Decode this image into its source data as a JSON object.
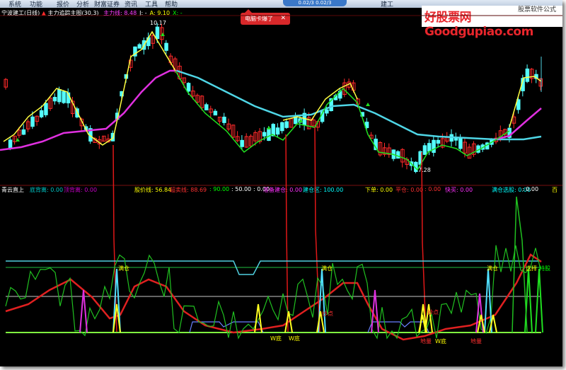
{
  "menu": {
    "items": [
      "系统",
      "功能",
      "报价",
      "分析",
      "财富证券",
      "资讯",
      "工具",
      "帮助"
    ],
    "top_pill": "0.02/3   0.02/3",
    "right_item": "建工"
  },
  "logo": {
    "text": "好股票网Goodgupiao.com",
    "sub": "股票软件公式"
  },
  "popup": {
    "text": "电脑卡爆了",
    "close": "✕"
  },
  "main_legend": {
    "stock": "宁波建工(日线)",
    "indicator": "主力追踪主图(30,3)",
    "fields": [
      {
        "label": "主力线:",
        "value": "8.48",
        "color": "#ff3bff"
      },
      {
        "label": "J:",
        "value": "-",
        "color": "#ffffff"
      },
      {
        "label": "A:",
        "value": "9.10",
        "color": "#ffff00"
      },
      {
        "label": "X:",
        "value": "-",
        "color": "#00ff00"
      }
    ],
    "icon_color": "#ff2a2a"
  },
  "main_annotations": {
    "high": "10.17",
    "low": "7.28"
  },
  "sub_legend": {
    "items": [
      {
        "text": "青云直上",
        "color": "#ffffff"
      },
      {
        "text": "底背离: 0.00",
        "color": "#00c8c8"
      },
      {
        "text": "顶背离: 0.00",
        "color": "#c800c8"
      },
      {
        "text": "股价线: 56.84",
        "color": "#ffff00"
      },
      {
        "text": "超卖线: 88.69",
        "color": "#ff3030"
      },
      {
        "text": ": 90.00",
        "color": "#00ff00"
      },
      {
        "text": ": 50.00",
        "color": "#ffffff"
      },
      {
        "text": ": 0.00",
        "color": "#ffffff"
      },
      {
        "text": "准备建仓: 0.00",
        "color": "#ff30ff"
      },
      {
        "text": "建仓区: 100.00",
        "color": "#00ffff"
      },
      {
        "text": "下单: 0.00",
        "color": "#ffff00"
      },
      {
        "text": "平仓: 0.00",
        "color": "#ff3030"
      },
      {
        "text": ": 0.00",
        "color": "#ff3030"
      },
      {
        "text": "快买: 0.00",
        "color": "#ff30ff"
      },
      {
        "text": "满仓选股: 0.00",
        "color": "#00ffff"
      },
      {
        "text": ": 0.00",
        "color": "#ffffff"
      },
      {
        "text": "百",
        "color": "#ffff00"
      }
    ]
  },
  "sub_annotations": [
    {
      "text": "满仓",
      "color": "#ffff00"
    },
    {
      "text": "满仓",
      "color": "#ffff00"
    },
    {
      "text": "满仓",
      "color": "#ffff00"
    },
    {
      "text": "选择",
      "color": "#ffff00"
    },
    {
      "text": "持股",
      "color": "#00ff00"
    },
    {
      "text": "W底",
      "color": "#ffff00"
    },
    {
      "text": "W底",
      "color": "#ffff00"
    },
    {
      "text": "抄点",
      "color": "#ff3030"
    },
    {
      "text": "地量",
      "color": "#ff3030"
    },
    {
      "text": "W底",
      "color": "#ffff00"
    },
    {
      "text": "地量",
      "color": "#ff3030"
    },
    {
      "text": "抄点",
      "color": "#ff3030"
    }
  ],
  "colors": {
    "background": "#000000",
    "up_candle": "#ff2a2a",
    "down_candle": "#54ffff",
    "ma_cyan": "#4fd6e6",
    "ma_magenta": "#e030e0",
    "line_yellow": "#ffff40",
    "line_green": "#20e020",
    "connector_red": "#e01818"
  }
}
